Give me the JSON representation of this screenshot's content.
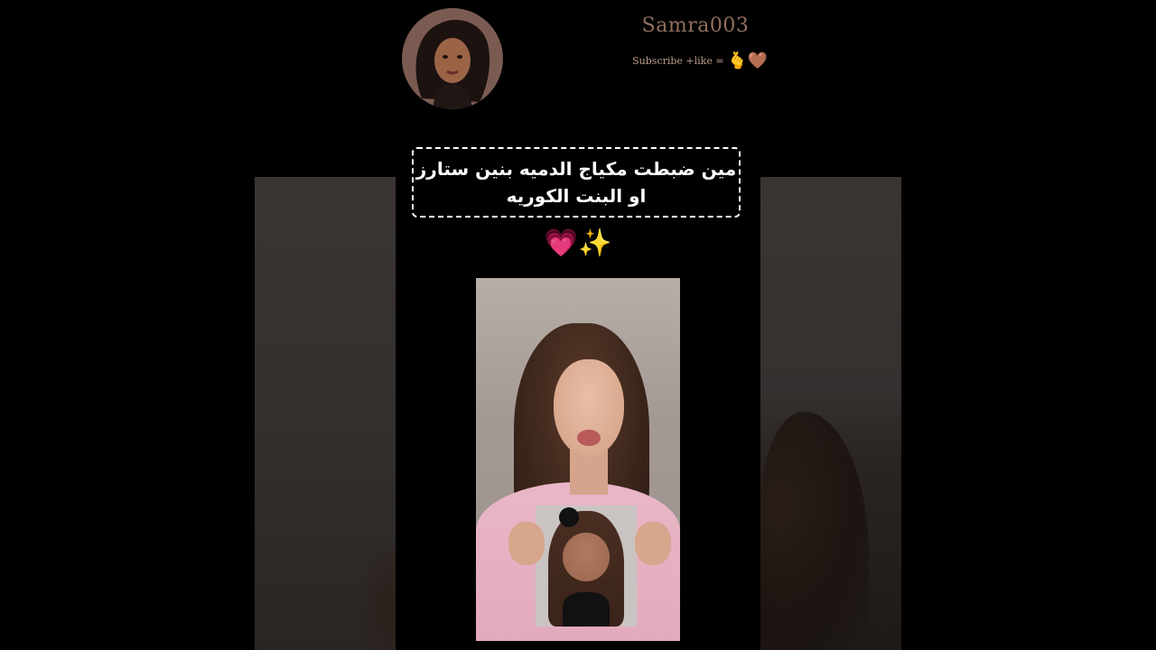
{
  "channel": {
    "name": "Samra003",
    "subscribe_text": "Subscribe +like =",
    "subscribe_emojis": "🫰🤎"
  },
  "caption": {
    "line1": "مين ضبطت مكياج الدميه بنين ستارز",
    "line2": "او البنت الكوريه",
    "emojis": "💗✨"
  },
  "colors": {
    "background": "#000000",
    "caption_text": "#ffffff",
    "channel_name": "#8f6f5e"
  }
}
